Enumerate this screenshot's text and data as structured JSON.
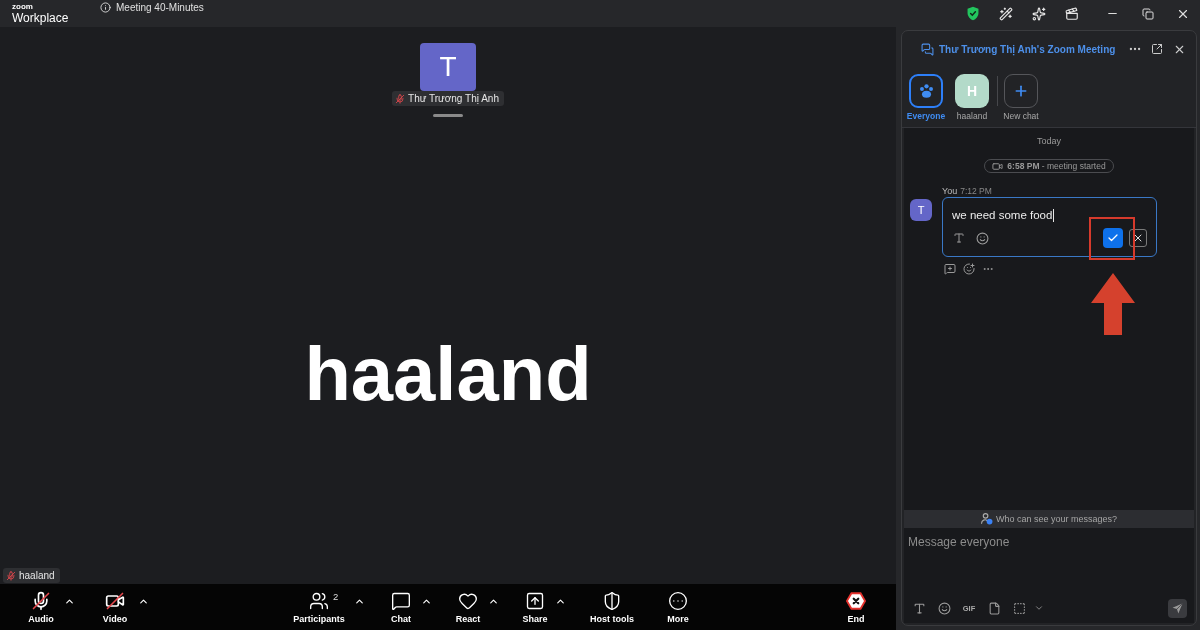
{
  "title_bar": {
    "logo": "zoom",
    "product": "Workplace",
    "meeting_info": "Meeting 40-Minutes"
  },
  "stage": {
    "host_tile": {
      "initial": "T",
      "name": "Thư Trương Thị Anh",
      "muted": true
    },
    "speaker": "haaland",
    "self_tag": {
      "name": "haaland",
      "muted": true
    }
  },
  "toolbar": {
    "media": [
      {
        "kind": "audio",
        "label": "Audio",
        "on": false,
        "caret": true
      },
      {
        "kind": "video",
        "label": "Video",
        "on": false,
        "caret": true
      }
    ],
    "controls": [
      {
        "kind": "participants",
        "label": "Participants",
        "count": "2",
        "caret": true
      },
      {
        "kind": "chat",
        "label": "Chat",
        "caret": true
      },
      {
        "kind": "react",
        "label": "React",
        "caret": true
      },
      {
        "kind": "share",
        "label": "Share",
        "caret": true
      },
      {
        "kind": "host_tools",
        "label": "Host tools",
        "caret": false
      },
      {
        "kind": "more",
        "label": "More",
        "caret": false
      }
    ],
    "end": {
      "label": "End"
    }
  },
  "chat": {
    "title": "Thư Trương Thị Anh's Zoom Meeting",
    "recipients": [
      {
        "kind": "everyone",
        "label": "Everyone",
        "selected": true
      },
      {
        "kind": "person",
        "initial": "H",
        "label": "haaland",
        "selected": false
      },
      {
        "kind": "new",
        "label": "New chat",
        "selected": false
      }
    ],
    "day": "Today",
    "event": "**6:58 PM** - meeting started",
    "messages": [
      {
        "sender": "You",
        "time": "7:12 PM",
        "avatar": "T",
        "text": "we need some food",
        "editing": true,
        "annotation": {
          "frame": true,
          "arrow": true
        }
      }
    ],
    "privacy_note": "Who can see your messages?",
    "composer": {
      "placeholder": "Message everyone",
      "gif": "GIF"
    }
  }
}
